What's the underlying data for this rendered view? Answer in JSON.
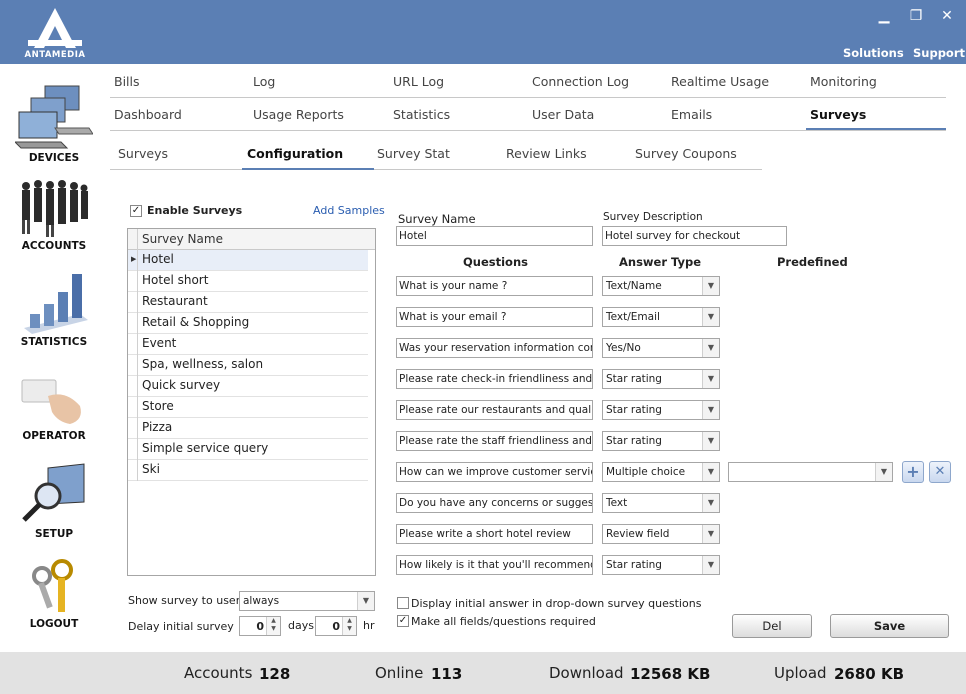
{
  "brand": {
    "name": "ANTAMEDIA"
  },
  "window": {
    "minimize": "▁",
    "restore": "❐",
    "close": "✕"
  },
  "toplinks": {
    "solutions": "Solutions",
    "support": "Support"
  },
  "sidebar": {
    "devices": "DEVICES",
    "accounts": "ACCOUNTS",
    "statistics": "STATISTICS",
    "operator": "OPERATOR",
    "setup": "SETUP",
    "logout": "LOGOUT"
  },
  "nav_row1": [
    "Bills",
    "Log",
    "URL Log",
    "Connection Log",
    "Realtime Usage",
    "Monitoring"
  ],
  "nav_row2": [
    "Dashboard",
    "Usage Reports",
    "Statistics",
    "User Data",
    "Emails",
    "Surveys"
  ],
  "subnav": [
    "Surveys",
    "Configuration",
    "Survey Stat",
    "Review Links",
    "Survey Coupons"
  ],
  "left_panel": {
    "enable_label": "Enable Surveys",
    "enable_checked": "✓",
    "add_samples": "Add Samples",
    "list_header": "Survey Name",
    "surveys": [
      "Hotel",
      "Hotel short",
      "Restaurant",
      "Retail & Shopping",
      "Event",
      "Spa, wellness, salon",
      "Quick survey",
      "Store",
      "Pizza",
      "Simple service query",
      "Ski"
    ],
    "show_label": "Show survey to user",
    "show_value": "always",
    "delay_label": "Delay initial survey",
    "delay_days": "0",
    "days_label": "days",
    "delay_hours": "0",
    "hr_label": "hr"
  },
  "right_panel": {
    "survey_name_label": "Survey Name",
    "survey_name_value": "Hotel",
    "survey_desc_label": "Survey Description",
    "survey_desc_value": "Hotel survey for checkout",
    "col_questions": "Questions",
    "col_answer_type": "Answer Type",
    "col_predefined": "Predefined",
    "questions": [
      {
        "q": "What is your name ?",
        "type": "Text/Name"
      },
      {
        "q": "What is your email ?",
        "type": "Text/Email"
      },
      {
        "q": "Was your reservation information correct?",
        "type": "Yes/No"
      },
      {
        "q": "Please rate check-in friendliness and efficiency",
        "type": "Star rating"
      },
      {
        "q": "Please rate our restaurants and quality of food",
        "type": "Star rating"
      },
      {
        "q": "Please rate the staff friendliness and professionalism",
        "type": "Star rating"
      },
      {
        "q": "How can we improve customer service ?",
        "type": "Multiple choice"
      },
      {
        "q": "Do you have any concerns or suggestions?",
        "type": "Text"
      },
      {
        "q": "Please write a short hotel review",
        "type": "Review field"
      },
      {
        "q": "How likely is it that you'll recommend our hotel?",
        "type": "Star rating"
      }
    ],
    "predefined_value": "",
    "add_icon": "+",
    "remove_icon": "✕",
    "opt_dropdown_label": "Display initial answer in drop-down survey questions",
    "opt_dropdown_checked": "",
    "opt_required_label": "Make all fields/questions required",
    "opt_required_checked": "✓",
    "del_label": "Del",
    "save_label": "Save"
  },
  "status": {
    "accounts_label": "Accounts",
    "accounts_value": "128",
    "online_label": "Online",
    "online_value": "113",
    "download_label": "Download",
    "download_value": "12568 KB",
    "upload_label": "Upload",
    "upload_value": "2680 KB"
  },
  "colors": {
    "accent": "#5b7fb4",
    "statusbar": "#e2e2e2"
  }
}
